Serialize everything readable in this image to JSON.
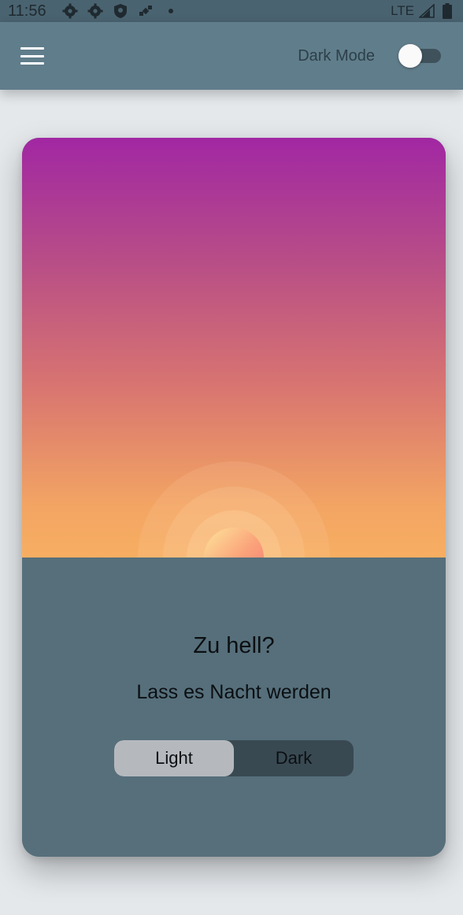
{
  "status_bar": {
    "time": "11:56",
    "network": "LTE",
    "icons": [
      "gear-icon",
      "gear-icon",
      "shield-icon",
      "satellite-icon",
      "dot-icon",
      "signal-icon",
      "battery-icon"
    ]
  },
  "app_bar": {
    "menu_icon": "hamburger-icon",
    "dark_mode_label": "Dark Mode",
    "dark_mode_enabled": false
  },
  "card": {
    "title": "Zu hell?",
    "subtitle": "Lass es Nacht werden",
    "segments": [
      {
        "label": "Light",
        "selected": true
      },
      {
        "label": "Dark",
        "selected": false
      }
    ]
  },
  "colors": {
    "app_bar": "#607d8b",
    "status_bar": "#4a6370",
    "card_bottom": "#566f7b",
    "sky_top": "#a127a3",
    "sky_bottom": "#f7ae62",
    "segment_active": "#b5b9bd",
    "segment_bg": "#394952"
  }
}
